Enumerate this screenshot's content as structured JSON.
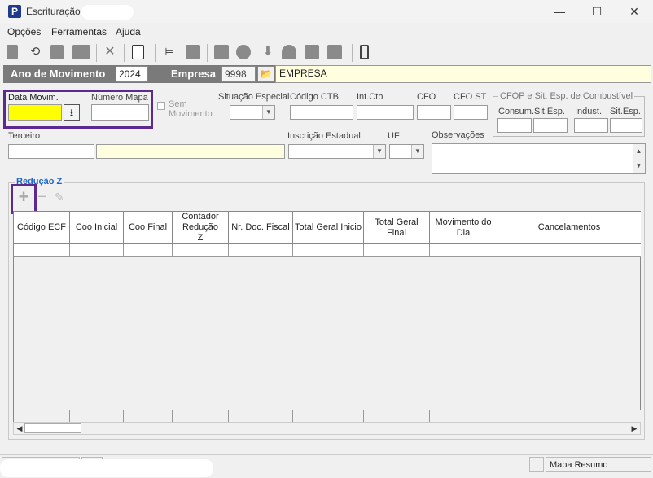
{
  "window": {
    "title": "Escrituração",
    "minimize": "—",
    "maximize": "☐",
    "close": "✕"
  },
  "menu": [
    "Opções",
    "Ferramentas",
    "Ajuda"
  ],
  "header": {
    "ano_label": "Ano de Movimento",
    "ano_value": "2024",
    "empresa_label": "Empresa",
    "empresa_code": "9998",
    "empresa_name": "EMPRESA"
  },
  "form": {
    "data_movim_label": "Data Movim.",
    "numero_mapa_label": "Número Mapa",
    "sem_movimento_label_1": "Sem",
    "sem_movimento_label_2": "Movimento",
    "situacao_label": "Situação Especial",
    "codigo_ctb_label": "Código CTB",
    "int_ctb_label": "Int.Ctb",
    "cfo_label": "CFO",
    "cfo_st_label": "CFO ST",
    "cfop_group_label": "CFOP e Sit. Esp. de Combustível",
    "consum_label": "Consum.",
    "sit_esp_label_1": "Sit.Esp.",
    "indust_label": "Indust.",
    "sit_esp_label_2": "Sit.Esp.",
    "terceiro_label": "Terceiro",
    "inscricao_label": "Inscrição Estadual",
    "uf_label": "UF",
    "observacoes_label": "Observações"
  },
  "reducao": {
    "group_label": "Redução Z",
    "columns": [
      "Código ECF",
      "Coo Inicial",
      "Coo Final",
      "Contador Redução Z",
      "Nr. Doc. Fiscal",
      "Total Geral Inicio",
      "Total Geral Final",
      "Movimento do Dia",
      "Cancelamentos"
    ]
  },
  "status": {
    "right_panel": "Mapa Resumo"
  },
  "colors": {
    "highlight_border": "#5c2a8f",
    "date_field_bg": "#ffff00",
    "header_band": "#7a7a7a",
    "group_label": "#1a66cc"
  }
}
